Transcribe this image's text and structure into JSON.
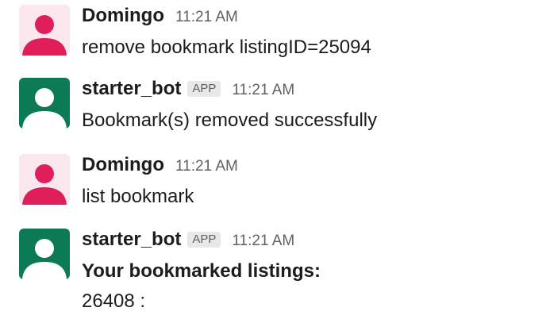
{
  "messages": [
    {
      "author": "Domingo",
      "time": "11:21 AM",
      "avatar_color": "#e01e5a",
      "lines": [
        "remove bookmark listingID=25094"
      ]
    },
    {
      "author": "starter_bot",
      "badge": "APP",
      "time": "11:21 AM",
      "avatar_color": "#0b7a55",
      "lines": [
        "Bookmark(s) removed successfully"
      ]
    },
    {
      "author": "Domingo",
      "time": "11:21 AM",
      "avatar_color": "#e01e5a",
      "lines": [
        "list bookmark"
      ]
    },
    {
      "author": "starter_bot",
      "badge": "APP",
      "time": "11:21 AM",
      "avatar_color": "#0b7a55",
      "lines": [
        "Your bookmarked listings:",
        "26408 :"
      ]
    }
  ]
}
